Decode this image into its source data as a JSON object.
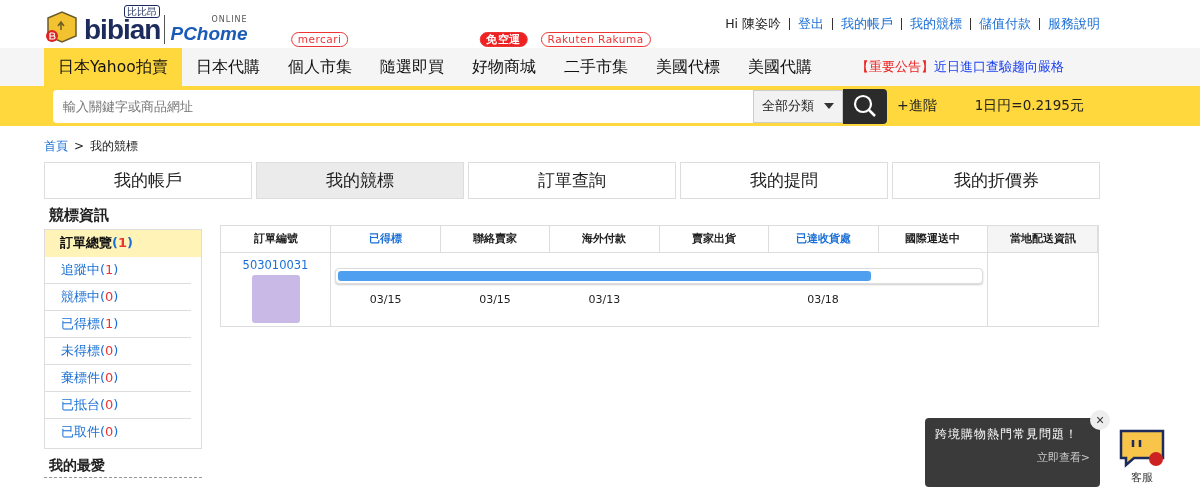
{
  "logo": {
    "name": "bibian",
    "badge": "比比昂",
    "partner": "PChome",
    "partner_sub": "ONLINE"
  },
  "top_links": {
    "greeting": "Hi 陳姿吟",
    "links": [
      "登出",
      "我的帳戶",
      "我的競標",
      "儲值付款",
      "服務說明"
    ]
  },
  "nav": {
    "items": [
      {
        "label": "日本Yahoo拍賣",
        "selected": true
      },
      {
        "label": "日本代購",
        "selected": false
      },
      {
        "label": "個人市集",
        "selected": false,
        "badge": {
          "text": "mercari",
          "kind": "outline"
        }
      },
      {
        "label": "隨選即買",
        "selected": false
      },
      {
        "label": "好物商城",
        "selected": false,
        "badge": {
          "text": "免空運",
          "kind": "filled"
        }
      },
      {
        "label": "二手市集",
        "selected": false,
        "badge": {
          "text": "Rakuten Rakuma",
          "kind": "outline"
        }
      },
      {
        "label": "美國代標",
        "selected": false
      },
      {
        "label": "美國代購",
        "selected": false
      }
    ],
    "notice": {
      "tag": "【重要公告】",
      "text": "近日進口查驗趨向嚴格"
    }
  },
  "search": {
    "placeholder": "輸入關鍵字或商品網址",
    "category": "全部分類",
    "advanced": "+進階",
    "rate": "1日円=0.2195元"
  },
  "breadcrumb": {
    "home": "首頁",
    "separator": ">",
    "current": "我的競標"
  },
  "tabs": [
    {
      "label": "我的帳戶",
      "selected": false
    },
    {
      "label": "我的競標",
      "selected": true
    },
    {
      "label": "訂單查詢",
      "selected": false
    },
    {
      "label": "我的提問",
      "selected": false
    },
    {
      "label": "我的折價券",
      "selected": false
    }
  ],
  "sidebar": {
    "title": "競標資訊",
    "items": [
      {
        "label": "訂單總覽",
        "count": "(1)",
        "selected": true
      },
      {
        "label": "追蹤中",
        "count": "(1)",
        "selected": false
      },
      {
        "label": "競標中",
        "count": "(0)",
        "selected": false
      },
      {
        "label": "已得標",
        "count": "(1)",
        "selected": false
      },
      {
        "label": "未得標",
        "count": "(0)",
        "selected": false
      },
      {
        "label": "棄標件",
        "count": "(0)",
        "selected": false
      },
      {
        "label": "已抵台",
        "count": "(0)",
        "selected": false
      },
      {
        "label": "已取件",
        "count": "(0)",
        "selected": false
      }
    ],
    "favorites_title": "我的最愛"
  },
  "order_table": {
    "id_header": "訂單編號",
    "stages": [
      {
        "label": "已得標",
        "reached": true,
        "date": "03/15"
      },
      {
        "label": "聯絡賣家",
        "reached": false,
        "date": "03/15"
      },
      {
        "label": "海外付款",
        "reached": false,
        "date": "03/13"
      },
      {
        "label": "賣家出貨",
        "reached": false
      },
      {
        "label": "已達收貨處",
        "reached": true,
        "date": "03/18"
      },
      {
        "label": "國際運送中",
        "reached": false
      }
    ],
    "local_header": "當地配送資訊",
    "rows": [
      {
        "order_id": "503010031",
        "level": 0.83
      }
    ]
  },
  "help_popup": {
    "title": "跨境購物熱門常見問題！",
    "link": "立即查看>",
    "close": "×"
  },
  "chat": {
    "label": "客服"
  }
}
